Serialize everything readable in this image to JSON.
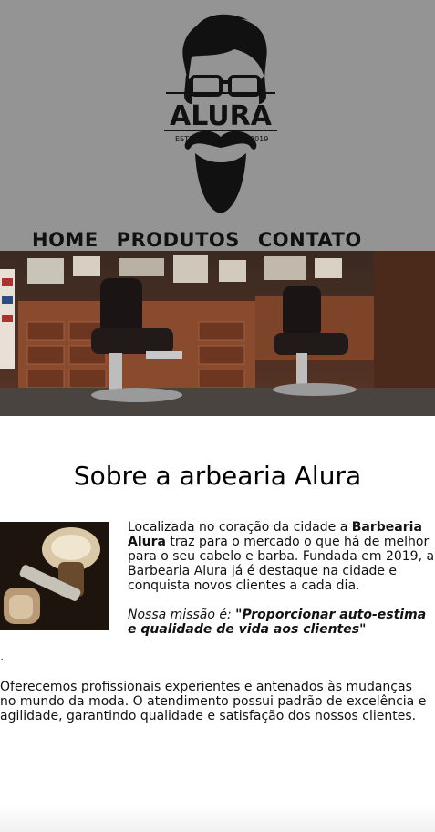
{
  "brand": {
    "name": "ALURA",
    "estd_left": "ESTD",
    "estd_right": "2019"
  },
  "nav": {
    "items": [
      "HOME",
      "PRODUTOS",
      "CONTATO"
    ]
  },
  "about": {
    "title": "Sobre a arbearia Alura",
    "intro_1": "Localizada no coração da cidade a ",
    "intro_brand": "Barbearia Alura",
    "intro_2": " traz para o mercado o que há de melhor para o seu cabelo e barba. Fundada em 2019, a Barbearia Alura já é destaque na cidade e conquista novos clientes a cada dia.",
    "mission_label": "Nossa missão é: ",
    "mission_text": "\"Proporcionar auto-estima e qualidade de vida aos clientes\"",
    "mission_end": ".",
    "extra": "Oferecemos profissionais experientes e antenados às mudanças no mundo da moda. O atendimento possui padrão de excelência e agilidade, garantindo qualidade e satisfação dos nossos clientes."
  },
  "colors": {
    "header_bg": "#949494",
    "page_bg": "#ffffff",
    "text": "#111111"
  }
}
